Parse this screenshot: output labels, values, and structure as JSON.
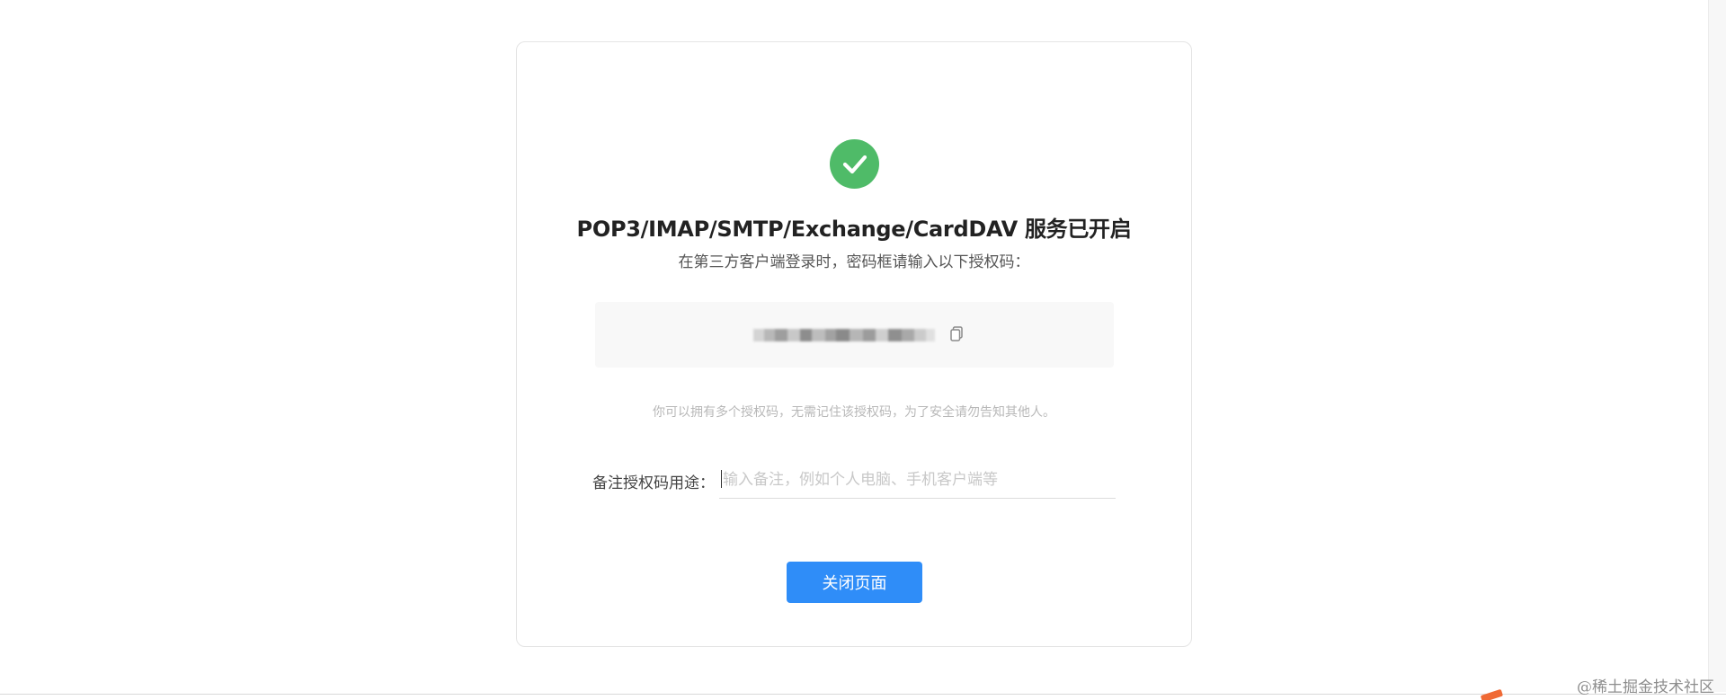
{
  "page": {
    "title": "POP3/IMAP/SMTP/Exchange/CardDAV 服务已开启",
    "subtitle": "在第三方客户端登录时，密码框请输入以下授权码：",
    "auth_code": "********************",
    "hint": "你可以拥有多个授权码，无需记住该授权码，为了安全请勿告知其他人。",
    "note_label": "备注授权码用途：",
    "note_placeholder": "输入备注，例如个人电脑、手机客户端等",
    "note_value": "",
    "close_button_label": "关闭页面",
    "watermark": "@稀土掘金技术社区"
  },
  "icons": {
    "success": "check-circle-icon",
    "copy": "copy-icon"
  },
  "colors": {
    "success": "#4fbb68",
    "primary_button": "#2f8df8",
    "hint_text": "#b8b8b8",
    "watermark_accent": "#f06a35"
  }
}
